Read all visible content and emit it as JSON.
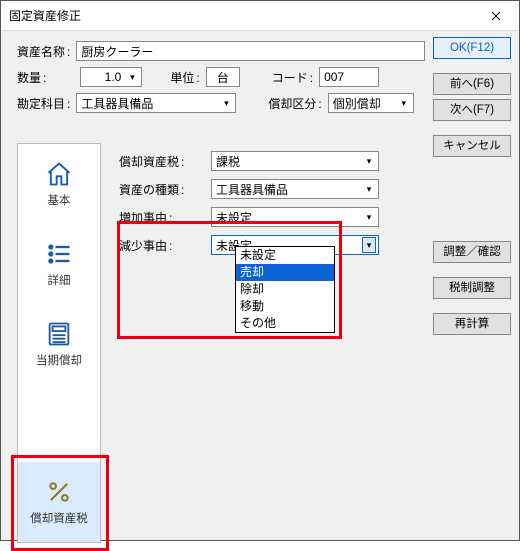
{
  "window": {
    "title": "固定資産修正"
  },
  "header": {
    "name_lbl": "資産名称",
    "name_val": "厨房クーラー",
    "qty_lbl": "数量",
    "qty_val": "1.0",
    "unit_lbl": "単位",
    "unit_val": "台",
    "code_lbl": "コード",
    "code_val": "007",
    "acct_lbl": "勘定科目",
    "acct_val": "工具器具備品",
    "dep_class_lbl": "償却区分",
    "dep_class_val": "個別償却"
  },
  "fields": {
    "dep_tax_lbl": "償却資産税",
    "dep_tax_val": "課税",
    "asset_type_lbl": "資産の種類",
    "asset_type_val": "工具器具備品",
    "inc_reason_lbl": "増加事由",
    "inc_reason_val": "未設定",
    "dec_reason_lbl": "減少事由",
    "dec_reason_val": "未設定"
  },
  "dec_options": {
    "o0": "未設定",
    "o1": "売却",
    "o2": "除却",
    "o3": "移動",
    "o4": "その他"
  },
  "nav": {
    "basic": "基本",
    "detail": "詳細",
    "curdep": "当期償却",
    "deptax": "償却資産税"
  },
  "buttons": {
    "ok": "OK(F12)",
    "prev": "前へ(F6)",
    "next": "次へ(F7)",
    "cancel": "キャンセル",
    "adjust": "調整／確認",
    "taxadj": "税制調整",
    "recalc": "再計算"
  }
}
